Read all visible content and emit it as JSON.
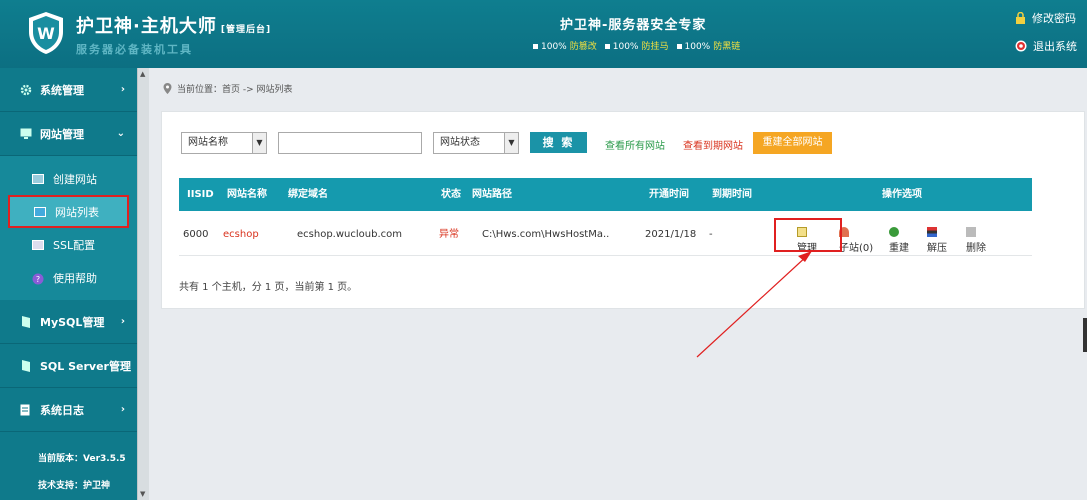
{
  "header": {
    "brand": "护卫神·主机大师",
    "brand_tag": "[管理后台]",
    "slogan": "服务器必备装机工具",
    "center_title": "护卫神-服务器安全专家",
    "stats": [
      {
        "pct": "100%",
        "label": "防篡改"
      },
      {
        "pct": "100%",
        "label": "防挂马"
      },
      {
        "pct": "100%",
        "label": "防黑链"
      }
    ],
    "change_password": "修改密码",
    "logout": "退出系统"
  },
  "sidebar": {
    "groups": [
      {
        "label": "系统管理",
        "arrow": "›"
      },
      {
        "label": "网站管理",
        "arrow": "⌄"
      }
    ],
    "sub_items": [
      {
        "label": "创建网站"
      },
      {
        "label": "网站列表"
      },
      {
        "label": "SSL配置"
      },
      {
        "label": "使用帮助"
      }
    ],
    "groups_after": [
      {
        "label": "MySQL管理",
        "arrow": "›"
      },
      {
        "label": "SQL Server管理",
        "arrow": "›"
      },
      {
        "label": "系统日志",
        "arrow": "›"
      }
    ],
    "version": "当前版本：Ver3.5.5",
    "support": "技术支持：护卫神"
  },
  "breadcrumb": "当前位置：首页 -> 网站列表",
  "filters": {
    "name_select": "网站名称",
    "status_select": "网站状态",
    "search_value": "",
    "search_btn": "搜 索",
    "view_all": "查看所有网站",
    "view_expired": "查看到期网站",
    "rebuild_all": "重建全部网站"
  },
  "colors": {
    "view_all": "#2a9a4a",
    "view_expired": "#d9331e",
    "status_abnormal": "#d9331e"
  },
  "table": {
    "headers": [
      "IISID",
      "网站名称",
      "绑定域名",
      "状态",
      "网站路径",
      "开通时间",
      "到期时间",
      "操作选项"
    ],
    "rows": [
      {
        "iisid": "6000",
        "name": "ecshop",
        "domain": "ecshop.wucloub.com",
        "status": "异常",
        "path": "C:\\Hws.com\\HwsHostMa..",
        "open_date": "2021/1/18",
        "expire_date": "-",
        "ops": {
          "manage": "管理",
          "subsite": "子站(0)",
          "rebuild": "重建",
          "unzip": "解压",
          "delete": "删除"
        }
      }
    ]
  },
  "summary": "共有 1 个主机，分 1 页，当前第 1 页。"
}
